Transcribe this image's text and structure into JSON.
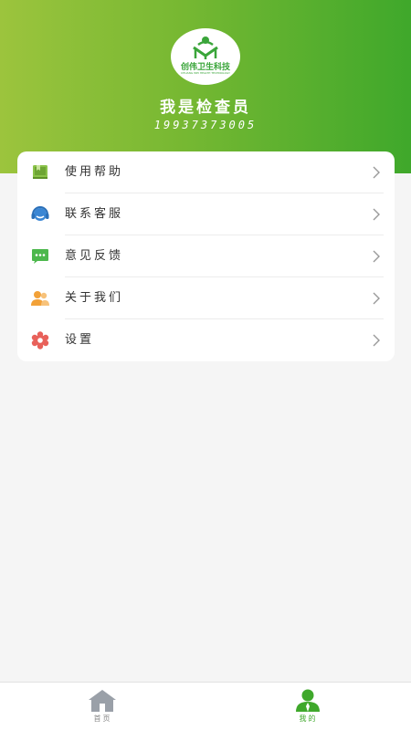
{
  "profile": {
    "logo_text": "创伟卫生科技",
    "logo_subtext": "CHUANG WEI HEALTH TECHNOLOGY",
    "name": "我是检查员",
    "phone": "19937373005"
  },
  "menu": {
    "items": [
      {
        "label": "使用帮助",
        "icon": "book-icon",
        "color": "#8bc34a"
      },
      {
        "label": "联系客服",
        "icon": "headset-icon",
        "color": "#3a86d4"
      },
      {
        "label": "意见反馈",
        "icon": "chat-bubble-icon",
        "color": "#4cb84c"
      },
      {
        "label": "关于我们",
        "icon": "users-icon",
        "color": "#f2a138"
      },
      {
        "label": "设置",
        "icon": "gear-icon",
        "color": "#e8615a"
      }
    ]
  },
  "tabbar": {
    "tabs": [
      {
        "label": "首页",
        "icon": "home-icon",
        "active": false
      },
      {
        "label": "我的",
        "icon": "user-icon",
        "active": true
      }
    ]
  },
  "colors": {
    "header_gradient_start": "#9cc43d",
    "header_gradient_end": "#3fa82b",
    "active_tab": "#3fa82b",
    "inactive_tab": "#888888"
  }
}
